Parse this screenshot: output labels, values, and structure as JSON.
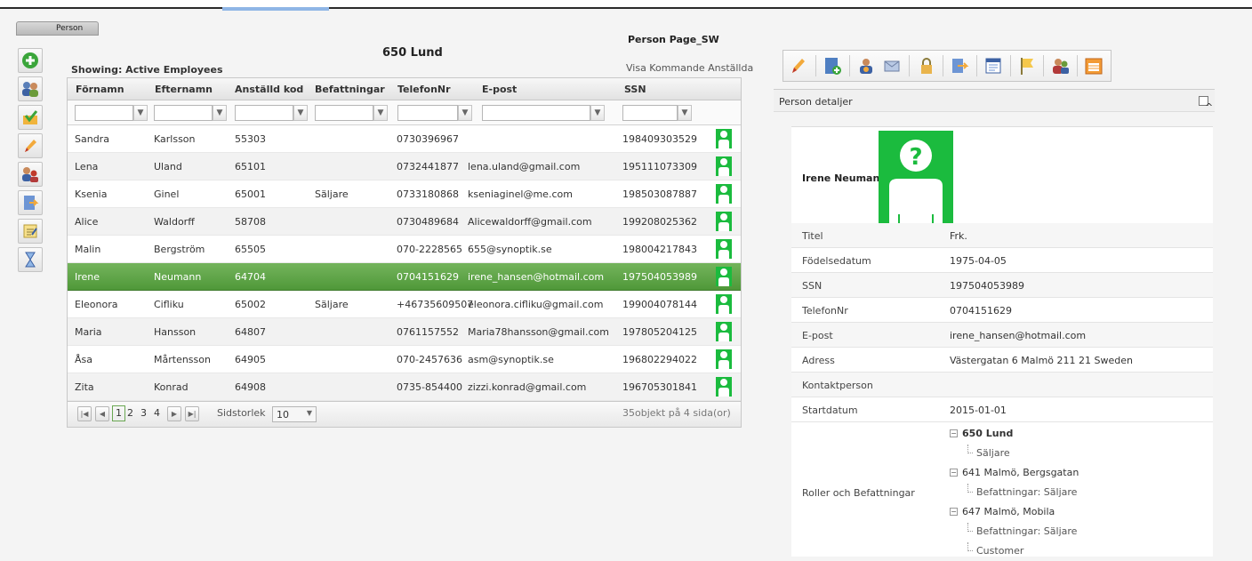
{
  "tab": {
    "label": "Person"
  },
  "header": {
    "title": "650 Lund",
    "page_name": "Person Page_SW",
    "showing": "Showing: Active Employees",
    "visa_link": "Visa Kommande Anställda"
  },
  "left_toolbar": [
    "add-icon",
    "users-icon",
    "approve-icon",
    "edit-icon",
    "user-group-icon",
    "export-icon",
    "notes-icon",
    "hourglass-icon"
  ],
  "grid": {
    "columns": [
      "Förnamn",
      "Efternamn",
      "Anställd kod",
      "Befattningar",
      "TelefonNr",
      "E-post",
      "SSN"
    ],
    "rows": [
      {
        "first": "Sandra",
        "last": "Karlsson",
        "code": "55303",
        "role": "",
        "phone": "0730396967",
        "email": "",
        "ssn": "198409303529"
      },
      {
        "first": "Lena",
        "last": "Uland",
        "code": "65101",
        "role": "",
        "phone": "0732441877",
        "email": "lena.uland@gmail.com",
        "ssn": "195111073309"
      },
      {
        "first": "Ksenia",
        "last": "Ginel",
        "code": "65001",
        "role": "Säljare",
        "phone": "0733180868",
        "email": "kseniaginel@me.com",
        "ssn": "198503087887"
      },
      {
        "first": "Alice",
        "last": "Waldorff",
        "code": "58708",
        "role": "",
        "phone": "0730489684",
        "email": "Alicewaldorff@gmail.com",
        "ssn": "199208025362"
      },
      {
        "first": "Malin",
        "last": "Bergström",
        "code": "65505",
        "role": "",
        "phone": "070-2228565",
        "email": "655@synoptik.se",
        "ssn": "198004217843"
      },
      {
        "first": "Irene",
        "last": "Neumann",
        "code": "64704",
        "role": "",
        "phone": "0704151629",
        "email": "irene_hansen@hotmail.com",
        "ssn": "197504053989"
      },
      {
        "first": "Eleonora",
        "last": "Cifliku",
        "code": "65002",
        "role": "Säljare",
        "phone": "+46735609507",
        "email": "eleonora.cifliku@gmail.com",
        "ssn": "199004078144"
      },
      {
        "first": "Maria",
        "last": "Hansson",
        "code": "64807",
        "role": "",
        "phone": "0761157552",
        "email": "Maria78hansson@gmail.com",
        "ssn": "197805204125"
      },
      {
        "first": "Åsa",
        "last": "Mårtensson",
        "code": "64905",
        "role": "",
        "phone": "070-2457636",
        "email": "asm@synoptik.se",
        "ssn": "196802294022"
      },
      {
        "first": "Zita",
        "last": "Konrad",
        "code": "64908",
        "role": "",
        "phone": "0735-854400",
        "email": "zizzi.konrad@gmail.com",
        "ssn": "196705301841"
      }
    ],
    "selected_row": 5,
    "pager": {
      "pages": [
        "1",
        "2",
        "3",
        "4"
      ],
      "current": "1",
      "size_label": "Sidstorlek",
      "size_value": "10",
      "summary": "35objekt på 4 sida(or)"
    }
  },
  "right_toolbar": [
    "pencil-icon",
    "add-document-icon",
    "user-settings-icon",
    "mail-icon",
    "lock-icon",
    "export-icon",
    "list-icon",
    "flag-icon",
    "users-icon",
    "calendar-icon"
  ],
  "details": {
    "panel_title": "Person detaljer",
    "name": "Irene Neumann",
    "fields": [
      {
        "label": "Titel",
        "value": "Frk."
      },
      {
        "label": "Födelsedatum",
        "value": "1975-04-05"
      },
      {
        "label": "SSN",
        "value": "197504053989"
      },
      {
        "label": "TelefonNr",
        "value": "0704151629"
      },
      {
        "label": "E-post",
        "value": "irene_hansen@hotmail.com"
      },
      {
        "label": "Adress",
        "value": "Västergatan 6 Malmö 211 21 Sweden"
      },
      {
        "label": "Kontaktperson",
        "value": ""
      },
      {
        "label": "Startdatum",
        "value": "2015-01-01"
      }
    ],
    "roles_label": "Roller och Befattningar",
    "roles_tree": [
      {
        "text": "650 Lund",
        "level": 0,
        "bold": true
      },
      {
        "text": "Säljare",
        "level": 1,
        "bold": false
      },
      {
        "text": "641 Malmö, Bergsgatan",
        "level": 0,
        "bold": false
      },
      {
        "text": "Befattningar: Säljare",
        "level": 1,
        "bold": false
      },
      {
        "text": "647 Malmö, Mobila",
        "level": 0,
        "bold": false
      },
      {
        "text": "Befattningar: Säljare",
        "level": 1,
        "bold": false
      },
      {
        "text": "Customer",
        "level": 1,
        "bold": false
      }
    ]
  },
  "colors": {
    "selected_row": "#5fa647",
    "avatar_green": "#1bbb3e"
  }
}
